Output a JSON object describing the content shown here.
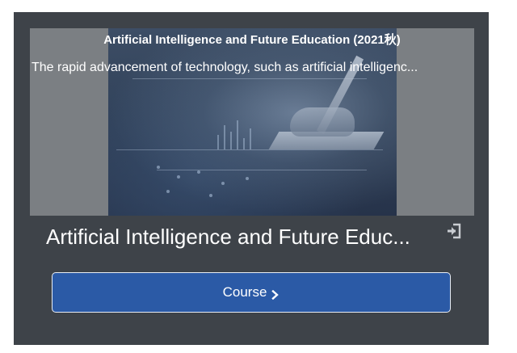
{
  "card": {
    "banner": {
      "title": "Artificial Intelligence and Future Education (2021秋)",
      "description": "The rapid advancement of technology, such as artificial intelligenc..."
    },
    "title": "Artificial Intelligence and Future Educ...",
    "exit_icon": "exit-icon",
    "course_button": {
      "label": "Course",
      "icon": "chevron-right-icon"
    }
  },
  "colors": {
    "card_background": "#3e4349",
    "banner_background": "#7b7f83",
    "button_background": "#2b5aa6",
    "text": "#ffffff"
  }
}
